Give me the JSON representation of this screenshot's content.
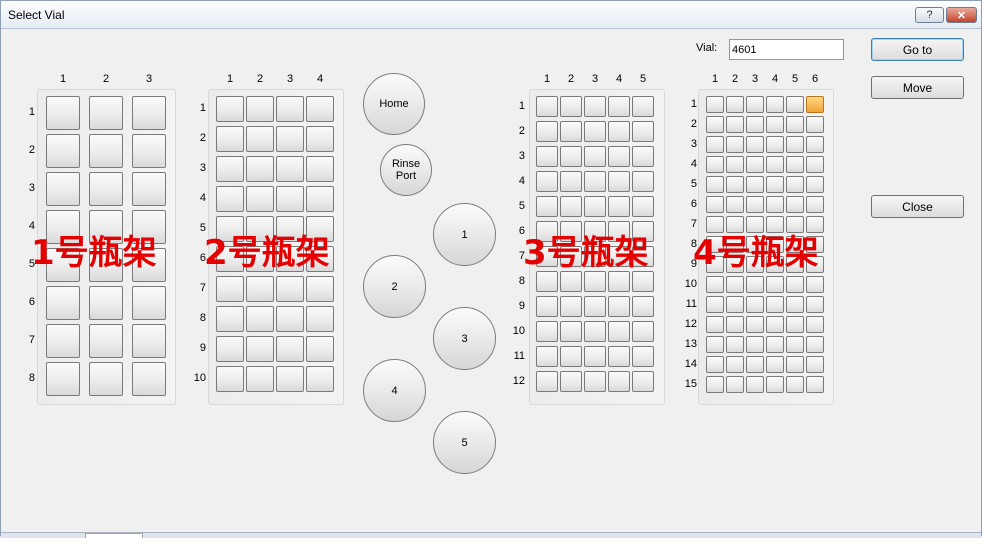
{
  "window": {
    "title": "Select Vial",
    "help_label": "?",
    "close_label": "✕"
  },
  "vial": {
    "label": "Vial:",
    "value": "4601"
  },
  "buttons": {
    "goto": "Go to",
    "move": "Move",
    "close": "Close"
  },
  "circle_buttons": {
    "home": "Home",
    "rinse": "Rinse Port",
    "p1": "1",
    "p2": "2",
    "p3": "3",
    "p4": "4",
    "p5": "5"
  },
  "overlays": {
    "rack1": "1号瓶架",
    "rack2": "2号瓶架",
    "rack3": "3号瓶架",
    "rack4": "4号瓶架"
  },
  "racks": [
    {
      "id": "rack1",
      "cols": [
        "1",
        "2",
        "3"
      ],
      "rows": [
        "1",
        "2",
        "3",
        "4",
        "5",
        "6",
        "7",
        "8"
      ],
      "selected": null
    },
    {
      "id": "rack2",
      "cols": [
        "1",
        "2",
        "3",
        "4"
      ],
      "rows": [
        "1",
        "2",
        "3",
        "4",
        "5",
        "6",
        "7",
        "8",
        "9",
        "10"
      ],
      "selected": null
    },
    {
      "id": "rack3",
      "cols": [
        "1",
        "2",
        "3",
        "4",
        "5"
      ],
      "rows": [
        "1",
        "2",
        "3",
        "4",
        "5",
        "6",
        "7",
        "8",
        "9",
        "10",
        "11",
        "12"
      ],
      "selected": null
    },
    {
      "id": "rack4",
      "cols": [
        "1",
        "2",
        "3",
        "4",
        "5",
        "6"
      ],
      "rows": [
        "1",
        "2",
        "3",
        "4",
        "5",
        "6",
        "7",
        "8",
        "9",
        "10",
        "11",
        "12",
        "13",
        "14",
        "15"
      ],
      "selected": {
        "row": 1,
        "col": 6
      }
    }
  ]
}
